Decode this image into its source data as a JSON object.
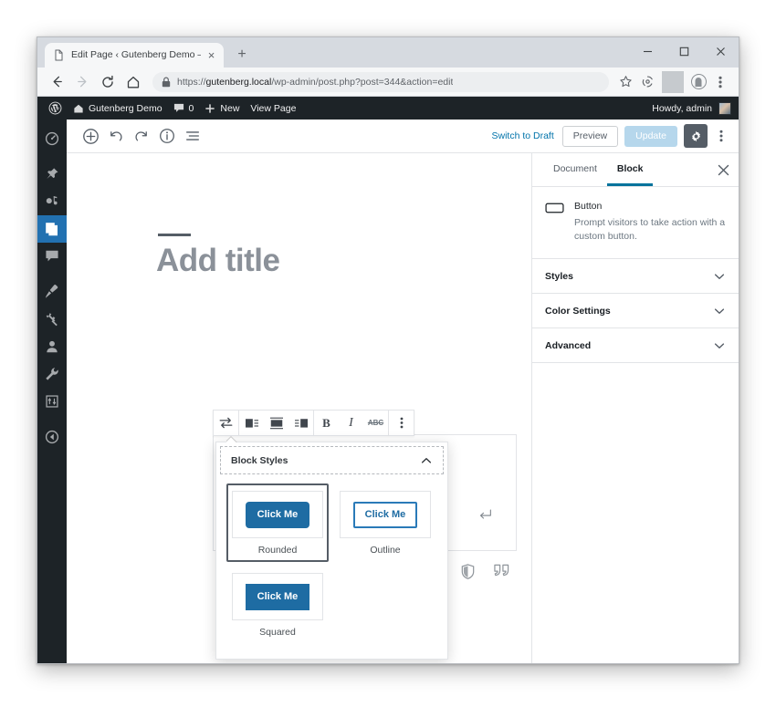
{
  "browser": {
    "tab": {
      "title": "Edit Page ‹ Gutenberg Demo — \\",
      "favicon": "page-icon",
      "close": "×"
    },
    "new_tab": "+",
    "window_controls": {
      "minimize": "–",
      "maximize": "□",
      "close": "✕"
    },
    "nav": {
      "back": "←",
      "forward": "→",
      "reload": "C",
      "home": "⌂"
    },
    "url": {
      "scheme": "https://",
      "host": "gutenberg.local",
      "path": "/wp-admin/post.php?post=344&action=edit",
      "full": "https://gutenberg.local/wp-admin/post.php?post=344&action=edit",
      "lock": "lock-icon"
    },
    "omni_icons": [
      "star-icon",
      "extension-icon",
      "profile-icon",
      "kebab-icon"
    ]
  },
  "adminbar": {
    "logo": "wordpress-logo",
    "site_name": "Gutenberg Demo",
    "comments_count": "0",
    "new_label": "New",
    "view_page_label": "View Page",
    "howdy": "Howdy, admin"
  },
  "adminmenu": {
    "items": [
      {
        "name": "dashboard",
        "icon": "dashboard-icon",
        "active": false
      },
      {
        "name": "posts",
        "icon": "pin-icon",
        "active": false
      },
      {
        "name": "media",
        "icon": "media-icon",
        "active": false
      },
      {
        "name": "pages",
        "icon": "pages-icon",
        "active": true
      },
      {
        "name": "comments",
        "icon": "comment-icon",
        "active": false
      },
      {
        "name": "appearance",
        "icon": "paintbrush-icon",
        "active": false
      },
      {
        "name": "plugins",
        "icon": "plug-icon",
        "active": false
      },
      {
        "name": "users",
        "icon": "user-icon",
        "active": false
      },
      {
        "name": "tools",
        "icon": "wrench-icon",
        "active": false
      },
      {
        "name": "settings",
        "icon": "settings-icon",
        "active": false
      },
      {
        "name": "collapse-menu",
        "icon": "collapse-icon",
        "active": false
      }
    ]
  },
  "editor_header": {
    "left_tools": [
      {
        "name": "add-block",
        "icon": "plus-circle-icon"
      },
      {
        "name": "undo",
        "icon": "undo-icon"
      },
      {
        "name": "redo",
        "icon": "redo-icon"
      },
      {
        "name": "content-info",
        "icon": "info-circle-icon"
      },
      {
        "name": "block-navigation",
        "icon": "list-view-icon"
      }
    ],
    "switch_to_draft": "Switch to Draft",
    "preview": "Preview",
    "update": "Update",
    "update_disabled": true,
    "settings_gear": "gear-icon",
    "more_menu": "kebab-icon"
  },
  "canvas": {
    "title_placeholder": "Add title",
    "placeholder_icons": [
      "shield-icon",
      "quote-icon"
    ],
    "enter_arrow": "enter-arrow-icon"
  },
  "block_toolbar": {
    "buttons": [
      {
        "name": "change-block-type",
        "icon": "transform-icon",
        "label": ""
      },
      {
        "name": "align-left",
        "icon": "align-left-icon",
        "label": ""
      },
      {
        "name": "align-center",
        "icon": "align-center-icon",
        "label": ""
      },
      {
        "name": "align-right",
        "icon": "align-right-icon",
        "label": ""
      },
      {
        "name": "bold",
        "icon": "bold-icon",
        "label": "B"
      },
      {
        "name": "italic",
        "icon": "italic-icon",
        "label": "I"
      },
      {
        "name": "strikethrough",
        "icon": "strikethrough-icon",
        "label": "ABC"
      },
      {
        "name": "more-rich-text",
        "icon": "kebab-icon",
        "label": ""
      }
    ]
  },
  "block_styles_popover": {
    "heading": "Block Styles",
    "collapse_icon": "chevron-up-icon",
    "styles": [
      {
        "label": "Rounded",
        "sample_text": "Click Me",
        "variant": "filled-rounded",
        "selected": true
      },
      {
        "label": "Outline",
        "sample_text": "Click Me",
        "variant": "outline",
        "selected": false
      },
      {
        "label": "Squared",
        "sample_text": "Click Me",
        "variant": "filled-squared",
        "selected": false
      }
    ],
    "button_color": "#1e6ca3",
    "outline_color": "#2a7ab8"
  },
  "inspector": {
    "tabs": [
      {
        "label": "Document",
        "active": false
      },
      {
        "label": "Block",
        "active": true
      }
    ],
    "close_icon": "close-icon",
    "block_card": {
      "icon": "button-block-icon",
      "title": "Button",
      "description": "Prompt visitors to take action with a custom button."
    },
    "panels": [
      {
        "label": "Styles",
        "icon": "chevron-down-icon"
      },
      {
        "label": "Color Settings",
        "icon": "chevron-down-icon"
      },
      {
        "label": "Advanced",
        "icon": "chevron-down-icon"
      }
    ]
  },
  "colors": {
    "wp_admin_dark": "#1d2327",
    "wp_blue": "#2271b1",
    "link_blue": "#0073aa",
    "accent_tab": "#00739c",
    "button_sample": "#1e6ca3"
  }
}
